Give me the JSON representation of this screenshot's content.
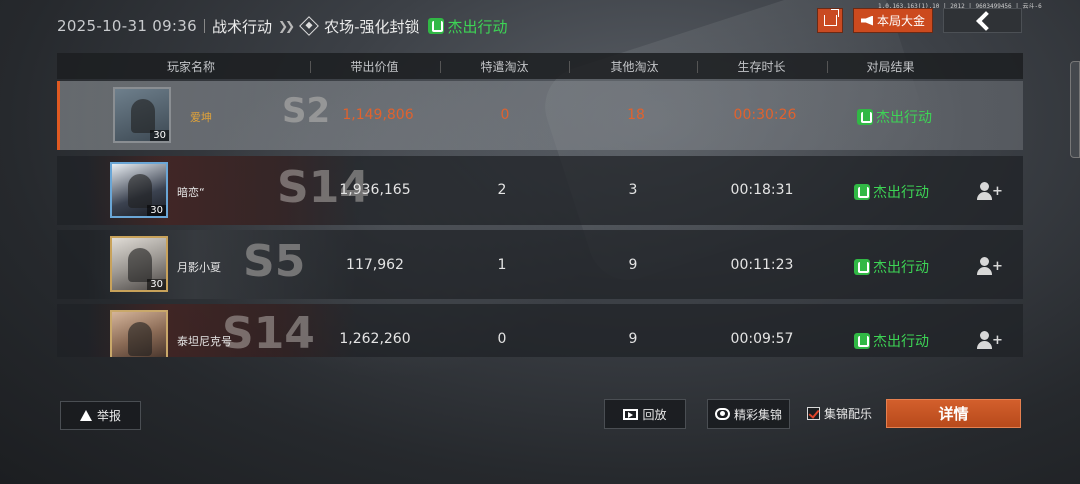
{
  "header": {
    "datetime": "2025-10-31 09:36",
    "mode": "战术行动",
    "map": "农场-强化封锁",
    "result": "杰出行动"
  },
  "top_buttons": {
    "share_icon": "share-icon",
    "bigmoney_label": "本局大金",
    "back_icon": "back-arrow-icon",
    "tiny_text": "1.0.163.163(1).10 | 2012 | 9603499456 | 云斗-6"
  },
  "table": {
    "headers": [
      "玩家名称",
      "带出价值",
      "特遣淘汰",
      "其他淘汰",
      "生存时长",
      "对局结果"
    ],
    "rows": [
      {
        "name": "爱坤",
        "level": "30",
        "value": "1,149,806",
        "special_kills": "0",
        "other_kills": "18",
        "survival": "00:30:26",
        "result": "杰出行动",
        "season": "S2",
        "is_self": true
      },
      {
        "name": "暗恋“",
        "level": "30",
        "value": "1,936,165",
        "special_kills": "2",
        "other_kills": "3",
        "survival": "00:18:31",
        "result": "杰出行动",
        "season": "S14",
        "is_self": false
      },
      {
        "name": "月影小夏",
        "level": "30",
        "value": "117,962",
        "special_kills": "1",
        "other_kills": "9",
        "survival": "00:11:23",
        "result": "杰出行动",
        "season": "S5",
        "is_self": false
      },
      {
        "name": "泰坦尼克号",
        "level": "",
        "value": "1,262,260",
        "special_kills": "0",
        "other_kills": "9",
        "survival": "00:09:57",
        "result": "杰出行动",
        "season": "S14",
        "is_self": false
      }
    ]
  },
  "bottom": {
    "report_label": "举报",
    "replay_label": "回放",
    "highlight_label": "精彩集锦",
    "music_label": "集锦配乐",
    "music_checked": true,
    "detail_label": "详情"
  },
  "colors": {
    "accent_orange": "#cc4a1e",
    "success_green": "#3dd455",
    "highlight_orange": "#e0622e",
    "self_name_gold": "#e0a23a"
  }
}
